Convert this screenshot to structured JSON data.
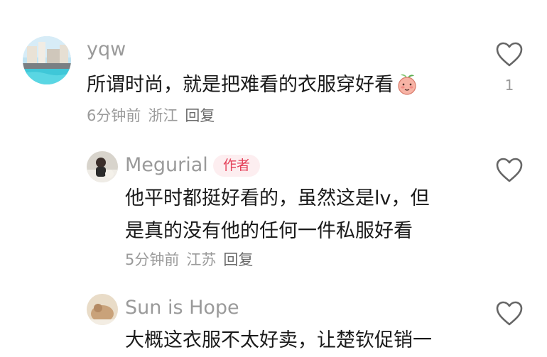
{
  "comments": [
    {
      "username": "yqw",
      "text": "所谓时尚，就是把难看的衣服穿好看",
      "emoji_icon": "peach-face-icon",
      "time": "6分钟前",
      "location": "浙江",
      "reply_label": "回复",
      "like_count": "1"
    },
    {
      "username": "Megurial",
      "badge": "作者",
      "text_lines": [
        "他平时都挺好看的，虽然这是lv，但",
        "是真的没有他的任何一件私服好看"
      ],
      "time": "5分钟前",
      "location": "江苏",
      "reply_label": "回复"
    },
    {
      "username": "Sun is Hope",
      "text_lines": [
        "大概这衣服不太好卖，让楚钦促销一"
      ]
    }
  ],
  "colors": {
    "username": "#9a9a9a",
    "badge_text": "#e4415a",
    "badge_bg": "#fdeef0",
    "content": "#1a1a1a",
    "heart_outline": "#666666"
  }
}
